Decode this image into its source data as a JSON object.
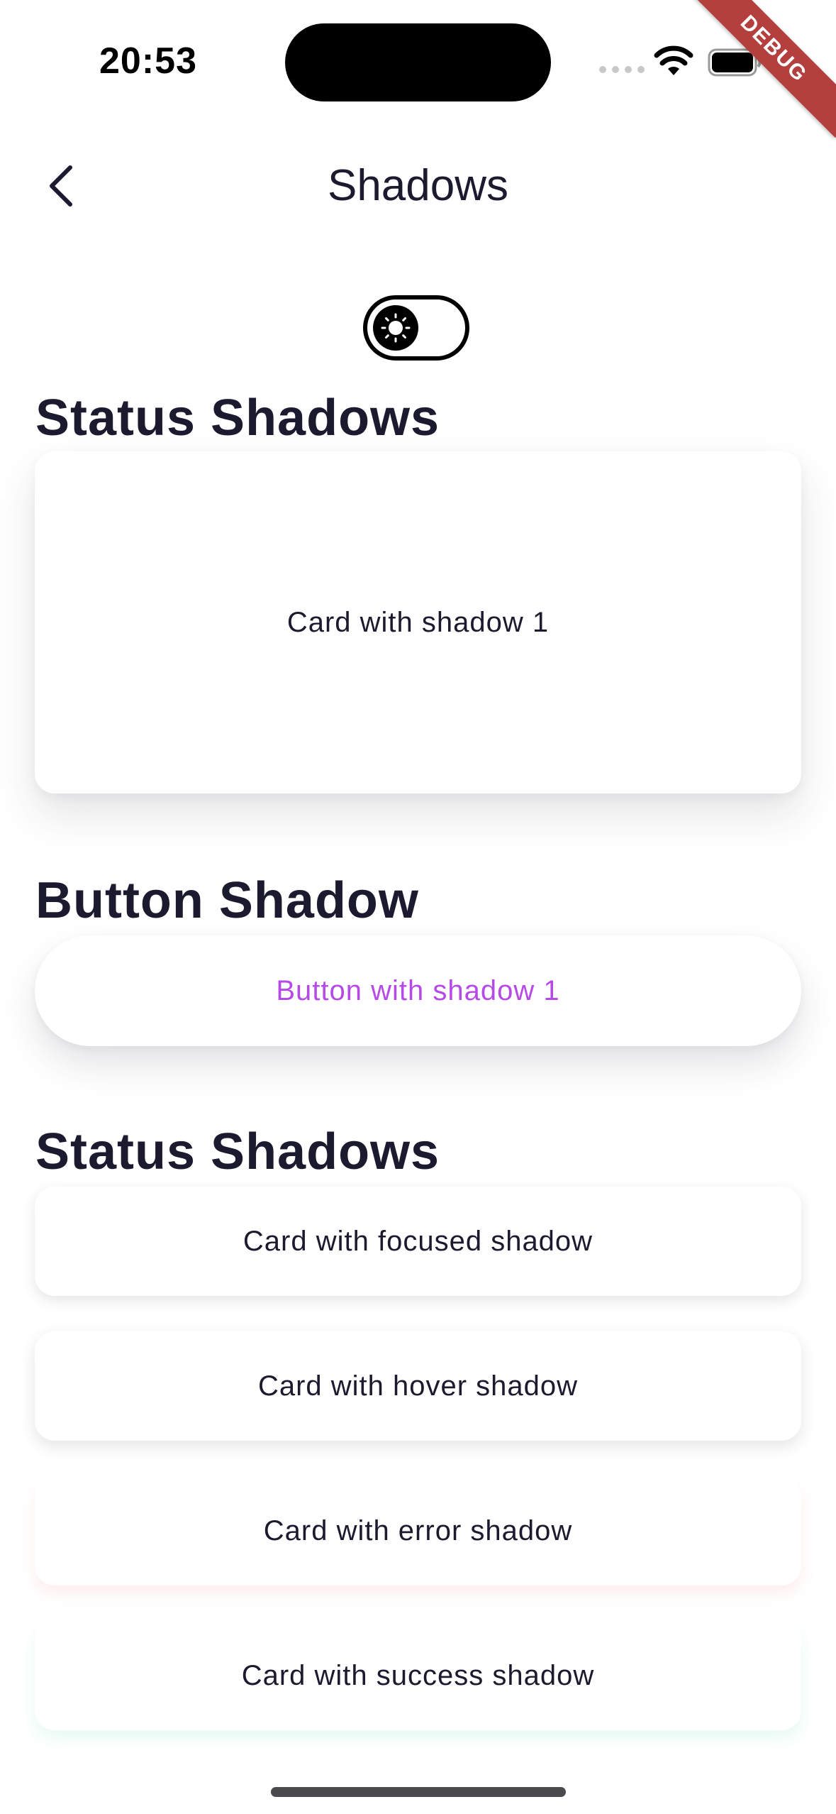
{
  "status_bar": {
    "time": "20:53",
    "icons": [
      "signal-dots-icon",
      "wifi-icon",
      "battery-icon"
    ]
  },
  "debug_banner": "DEBUG",
  "nav": {
    "back_icon": "chevron-left-icon",
    "title": "Shadows"
  },
  "theme_toggle": {
    "icon": "sun-icon",
    "state": "light"
  },
  "sections": [
    {
      "title": "Status Shadows",
      "cards": [
        "Card with shadow 1"
      ]
    },
    {
      "title": "Button Shadow",
      "button_label": "Button with shadow 1"
    },
    {
      "title": "Status Shadows",
      "cards": [
        "Card with focused shadow",
        "Card with hover shadow",
        "Card with error shadow",
        "Card with success shadow"
      ]
    }
  ],
  "colors": {
    "text": "#1b1a2e",
    "button_text": "#b64ae6",
    "debug_ribbon": "#b3403f",
    "error_shadow": "#ff7882",
    "success_shadow": "#5adcaa"
  }
}
